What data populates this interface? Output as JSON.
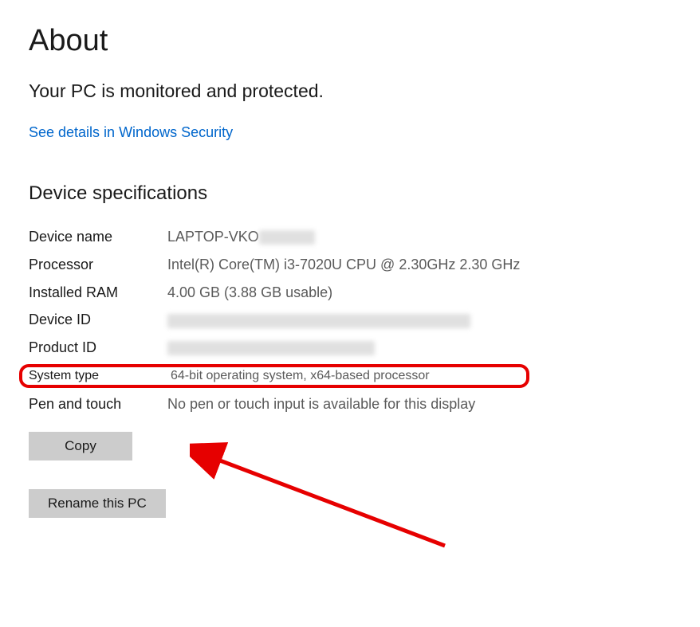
{
  "title": "About",
  "status": "Your PC is monitored and protected.",
  "security_link": "See details in Windows Security",
  "section_heading": "Device specifications",
  "specs": {
    "device_name": {
      "label": "Device name",
      "value": "LAPTOP-VKO"
    },
    "processor": {
      "label": "Processor",
      "value": "Intel(R) Core(TM) i3-7020U CPU @ 2.30GHz   2.30 GHz"
    },
    "installed_ram": {
      "label": "Installed RAM",
      "value": "4.00 GB (3.88 GB usable)"
    },
    "device_id": {
      "label": "Device ID",
      "value": ""
    },
    "product_id": {
      "label": "Product ID",
      "value": ""
    },
    "system_type": {
      "label": "System type",
      "value": "64-bit operating system, x64-based processor"
    },
    "pen_touch": {
      "label": "Pen and touch",
      "value": "No pen or touch input is available for this display"
    }
  },
  "buttons": {
    "copy": "Copy",
    "rename": "Rename this PC"
  },
  "annotation_color": "#e60000"
}
